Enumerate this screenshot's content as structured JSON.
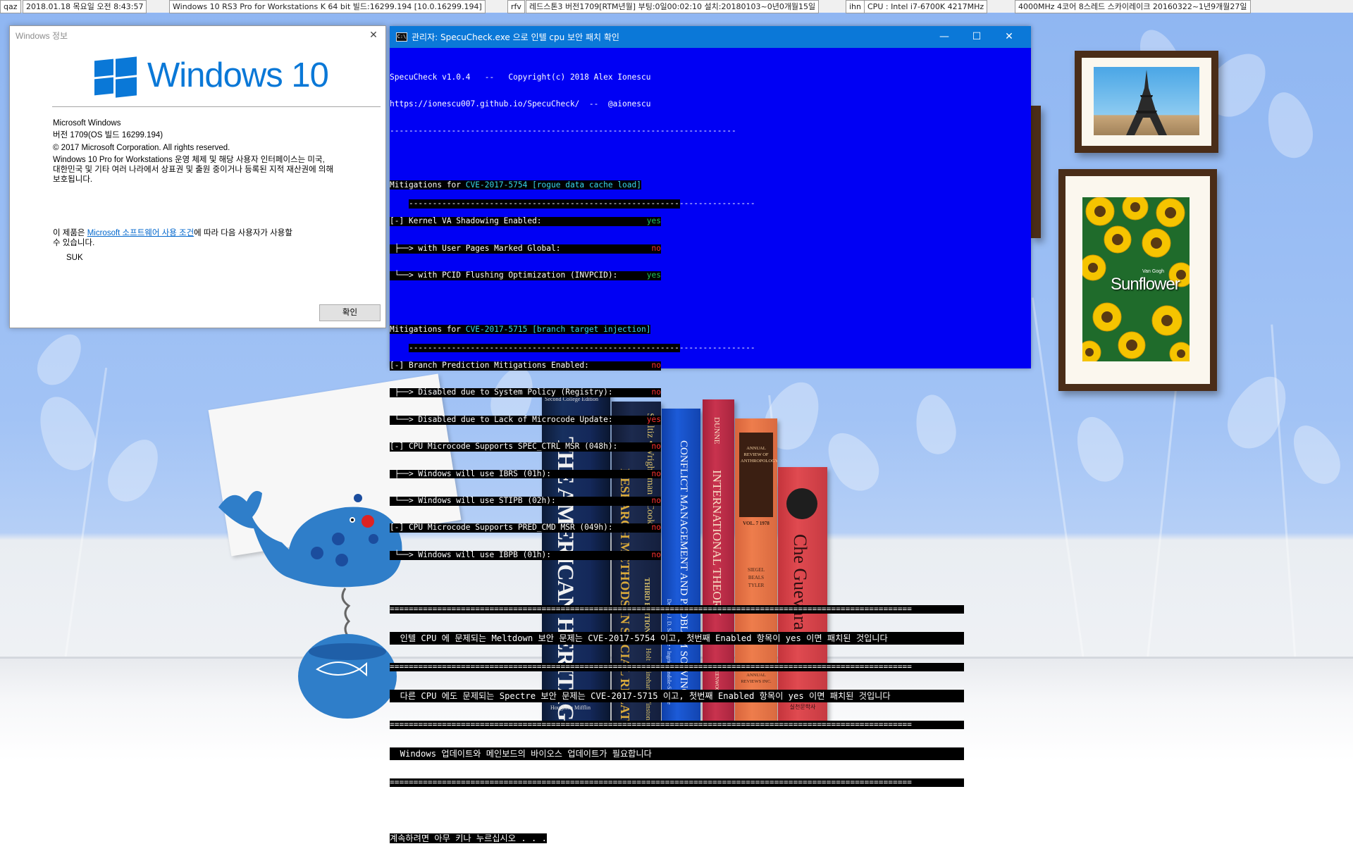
{
  "infobar": {
    "user": "qaz",
    "datetime": "2018.01.18 목요일  오전 8:43:57",
    "os": "Windows 10 RS3 Pro for Workstations K 64 bit 빌드:16299.194 [10.0.16299.194]",
    "tag2": "rfv",
    "install": "레드스톤3 버전1709[RTM년월] 부팅:0일00:02:10 설치:20180103~0년0개월15일",
    "tag3": "ihn",
    "cpu": "CPU : Intel i7-6700K 4217MHz",
    "cpu2": "4000MHz 4코어 8스레드 스카이레이크 20160322~1년9개월27일"
  },
  "winver": {
    "title": "Windows 정보",
    "logo_text": "Windows 10",
    "product": "Microsoft Windows",
    "version": "버전 1709(OS 빌드 16299.194)",
    "copyright": "© 2017 Microsoft Corporation. All rights reserved.",
    "desc1": "Windows 10 Pro for Workstations 운영 체제 및 해당 사용자 인터페이스는 미국,",
    "desc2": "대한민국 및 기타 여러 나라에서 상표권 및 출원 중이거나 등록된 지적 재산권에 의해",
    "desc3": "보호됩니다.",
    "license_pre": "이 제품은 ",
    "license_link": "Microsoft 소프트웨어 사용 조건",
    "license_post": "에 따라 다음 사용자가 사용할",
    "license_line2": "수 있습니다.",
    "user": "SUK",
    "ok": "확인",
    "close": "✕"
  },
  "console": {
    "title": "관리자:  SpecuCheck.exe 으로 인텔 cpu 보안 패치 확인",
    "minimize": "—",
    "maximize": "☐",
    "close": "✕",
    "header1": "SpecuCheck v1.0.4   --   Copyright(c) 2018 Alex Ionescu",
    "header2": "https://ionescu007.github.io/SpecuCheck/  --  @aionescu",
    "rule": "-------------------------------------------------------------------------",
    "sec1_pre": "Mitigations for ",
    "sec1_cve": "CVE-2017-5754 [rogue data cache load]",
    "kva1": "[-] Kernel VA Shadowing Enabled:",
    "kva1_val": "yes",
    "kva2": " ├──> with User Pages Marked Global:",
    "kva2_val": "no",
    "kva3": " └──> with PCID Flushing Optimization (INVPCID):",
    "kva3_val": "yes",
    "sec2_pre": "Mitigations for ",
    "sec2_cve": "CVE-2017-5715 [branch target injection]",
    "bp1": "[-] Branch Prediction Mitigations Enabled:",
    "bp1_val": "no",
    "bp2": " ├──> Disabled due to System Policy (Registry):",
    "bp2_val": "no",
    "bp3": " └──> Disabled due to Lack of Microcode Update:",
    "bp3_val": "yes",
    "bp4": "[-] CPU Microcode Supports SPEC_CTRL MSR (048h):",
    "bp4_val": "no",
    "bp5": " ├──> Windows will use IBRS (01h):",
    "bp5_val": "no",
    "bp6": " └──> Windows will use STIPB (02h):",
    "bp6_val": "no",
    "bp7": "[-] CPU Microcode Supports PRED_CMD MSR (049h):",
    "bp7_val": "no",
    "bp8": " └──> Windows will use IBPB (01h):",
    "bp8_val": "no",
    "eqrule": "==============================================================================================================",
    "msg1": "  인텔 CPU 에 문제되는 Meltdown 보안 문제는 CVE-2017-5754 이고, 첫번째 Enabled 항목이 yes 이면 패치된 것입니다",
    "msg2": "  다른 CPU 에도 문제되는 Spectre 보안 문제는 CVE-2017-5715 이고, 첫번째 Enabled 항목이 yes 이면 패치된 것입니다",
    "msg3": "  Windows 업데이트와 메인보드의 바이오스 업데이트가 필요합니다",
    "prompt": "계속하려면 아무 키나 누르십시오 . . ."
  },
  "frames": {
    "sunflower_title": "Sunflower",
    "sunflower_sub": "Van Gogh"
  },
  "books": [
    {
      "top": "Second College Edition",
      "title": "THE AMERICAN HERITAGE DICTIONARY",
      "publisher": "Houghton Mifflin"
    },
    {
      "title": "RESEARCH METHODS IN SOCIAL RELATIONS",
      "authors": "Selltiz • Wrightsman • Cook",
      "edition": "THIRD EDITION",
      "publisher": "Holt • Rinehart • Winston"
    },
    {
      "title": "CONFLICT MANAGEMENT AND PROBLEM SOLVING",
      "authors": "Dennis J. D. Sandole • Ingrid Sandole-Staroste"
    },
    {
      "author": "DUNNE",
      "title": "INTERNATIONAL THEORY",
      "publisher": "GREENWOOD"
    },
    {
      "title": "ANNUAL REVIEW OF ANTHROPOLOGY",
      "vol": "VOL. 7 1978",
      "editors": "SIEGEL BEALS TYLER",
      "publisher": "ANNUAL REVIEWS INC."
    },
    {
      "title": "Che Guevara",
      "publisher": "실천문학사"
    }
  ],
  "colors": {
    "accent": "#0a78d7",
    "console_bg": "#0000f4",
    "console_title": "#0b78d8",
    "yes": "#22c55e",
    "no": "#ff3030",
    "cve": "#3ad7f0"
  }
}
